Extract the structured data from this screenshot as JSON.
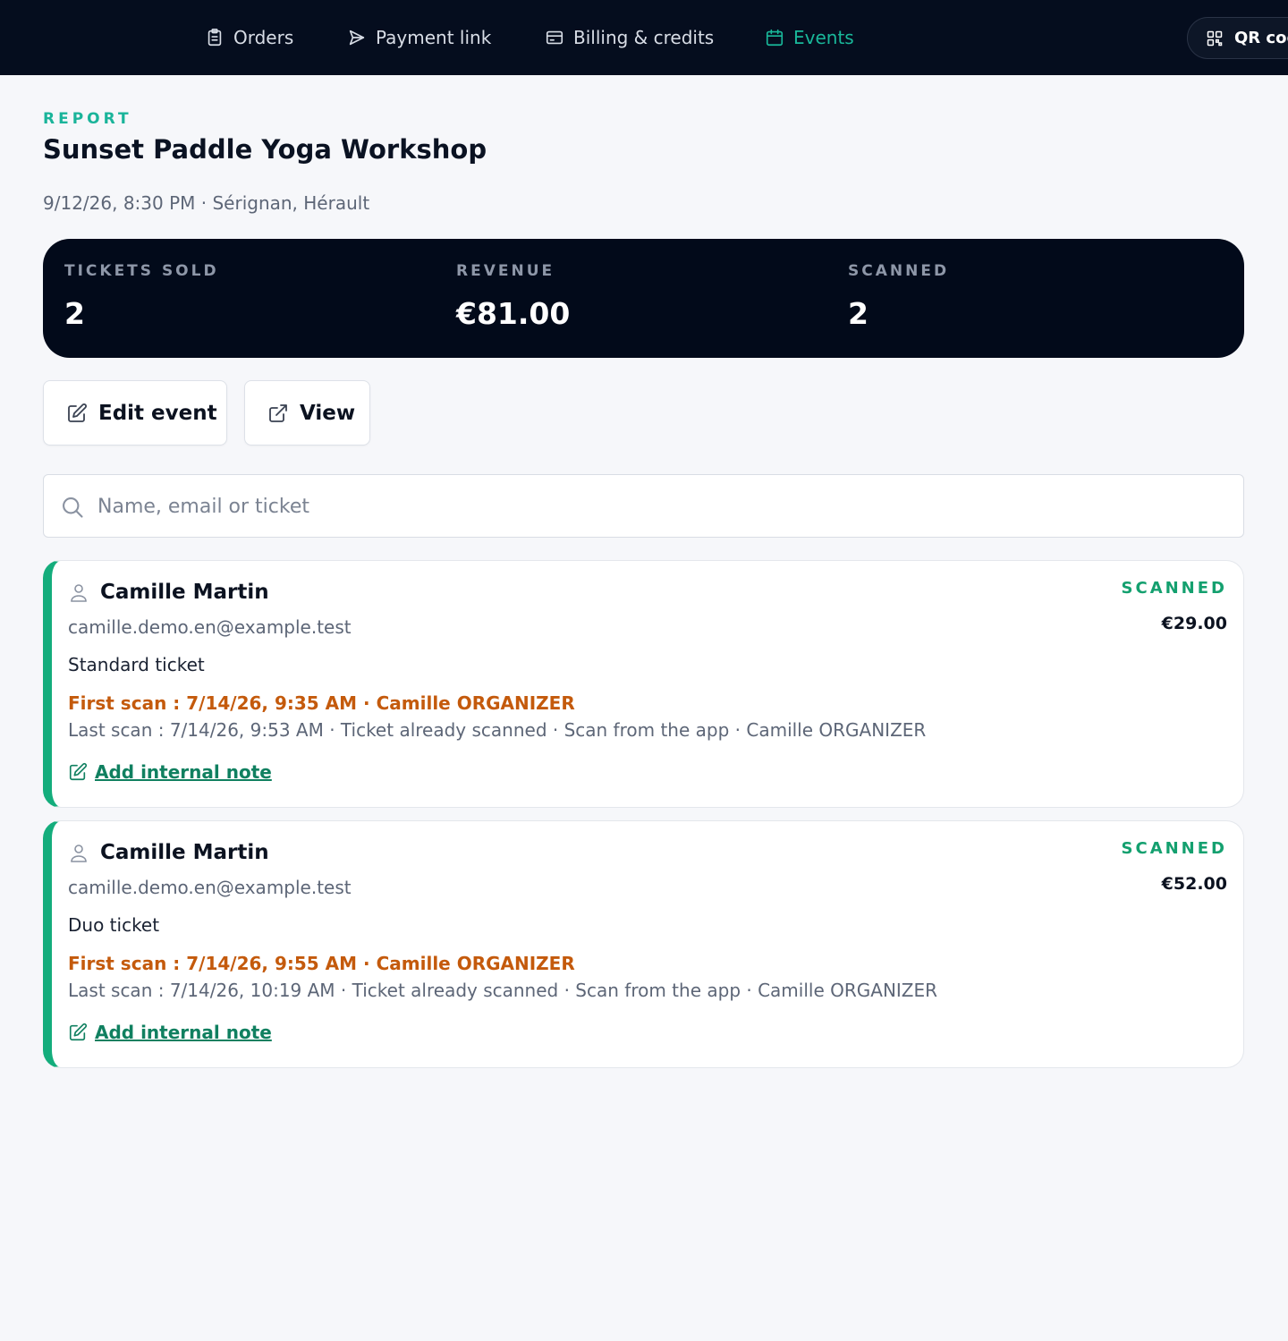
{
  "nav": {
    "items": [
      {
        "label": "Orders",
        "icon": "clipboard-icon"
      },
      {
        "label": "Payment link",
        "icon": "send-icon"
      },
      {
        "label": "Billing & credits",
        "icon": "credit-card-icon"
      },
      {
        "label": "Events",
        "icon": "calendar-icon",
        "active": true
      }
    ],
    "qr_label": "QR codes"
  },
  "header": {
    "eyebrow": "REPORT",
    "title": "Sunset Paddle Yoga Workshop",
    "subtitle": "9/12/26, 8:30 PM · Sérignan, Hérault"
  },
  "stats": {
    "tickets_sold": {
      "label": "TICKETS SOLD",
      "value": "2"
    },
    "revenue": {
      "label": "REVENUE",
      "value": "€81.00"
    },
    "scanned": {
      "label": "SCANNED",
      "value": "2"
    }
  },
  "actions": {
    "edit_label": "Edit event",
    "view_label": "View"
  },
  "search": {
    "placeholder": "Name, email or ticket",
    "value": ""
  },
  "tickets": [
    {
      "name": "Camille Martin",
      "email": "camille.demo.en@example.test",
      "ticket_type": "Standard ticket",
      "first_scan": "First scan : 7/14/26, 9:35 AM · Camille ORGANIZER",
      "last_scan": "Last scan : 7/14/26, 9:53 AM · Ticket already scanned · Scan from the app · Camille ORGANIZER",
      "note_label": "Add internal note",
      "status": "SCANNED",
      "price": "€29.00"
    },
    {
      "name": "Camille Martin",
      "email": "camille.demo.en@example.test",
      "ticket_type": "Duo ticket",
      "first_scan": "First scan : 7/14/26, 9:55 AM · Camille ORGANIZER",
      "last_scan": "Last scan : 7/14/26, 10:19 AM · Ticket already scanned · Scan from the app · Camille ORGANIZER",
      "note_label": "Add internal note",
      "status": "SCANNED",
      "price": "€52.00"
    }
  ],
  "colors": {
    "nav_bg": "#050d1e",
    "accent": "#19b89a",
    "scan_orange": "#c45a0c",
    "scanned_green": "#14a06f"
  }
}
